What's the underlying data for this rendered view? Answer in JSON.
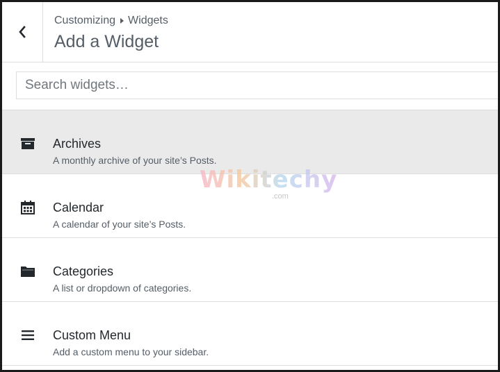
{
  "header": {
    "breadcrumb_root": "Customizing",
    "breadcrumb_current": "Widgets",
    "title": "Add a Widget",
    "back_icon": "chevron-left-icon"
  },
  "search": {
    "placeholder": "Search widgets…",
    "value": ""
  },
  "widgets": [
    {
      "title": "Archives",
      "description": "A monthly archive of your site’s Posts.",
      "icon": "archive-box-icon",
      "selected": true
    },
    {
      "title": "Calendar",
      "description": "A calendar of your site’s Posts.",
      "icon": "calendar-icon",
      "selected": false
    },
    {
      "title": "Categories",
      "description": "A list or dropdown of categories.",
      "icon": "folder-icon",
      "selected": false
    },
    {
      "title": "Custom Menu",
      "description": "Add a custom menu to your sidebar.",
      "icon": "hamburger-menu-icon",
      "selected": false
    }
  ],
  "watermark": {
    "text": "Wikitechy",
    "sub": ".com"
  },
  "colors": {
    "selected_row": "#eaeaea",
    "text_primary": "#23282d",
    "text_secondary": "#555d66",
    "border": "#dddddd",
    "frame": "#1a1a1a"
  }
}
